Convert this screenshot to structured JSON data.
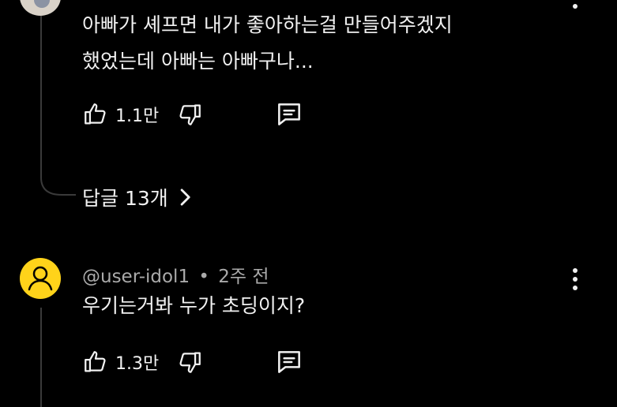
{
  "comments": [
    {
      "text_line1": "아빠가 셰프면 내가 좋아하는걸 만들어주겠지",
      "text_line2": "했었는데 아빠는 아빠구나...",
      "like_count": "1.1만",
      "icons": [
        "thumb-up-icon",
        "thumb-down-icon",
        "reply-icon",
        "more-vert-icon"
      ],
      "replies_label": "답글 13개"
    },
    {
      "author": "@user-idol1",
      "separator": "•",
      "time": "2주 전",
      "text": "우기는거봐 누가 초딩이지?",
      "like_count": "1.3만",
      "icons": [
        "avatar-user-icon",
        "thumb-up-icon",
        "thumb-down-icon",
        "reply-icon",
        "more-vert-icon"
      ]
    }
  ],
  "colors": {
    "background": "#000000",
    "text": "#f1f1f1",
    "meta": "#aaaaaa",
    "avatar2": "#ffd31a"
  }
}
